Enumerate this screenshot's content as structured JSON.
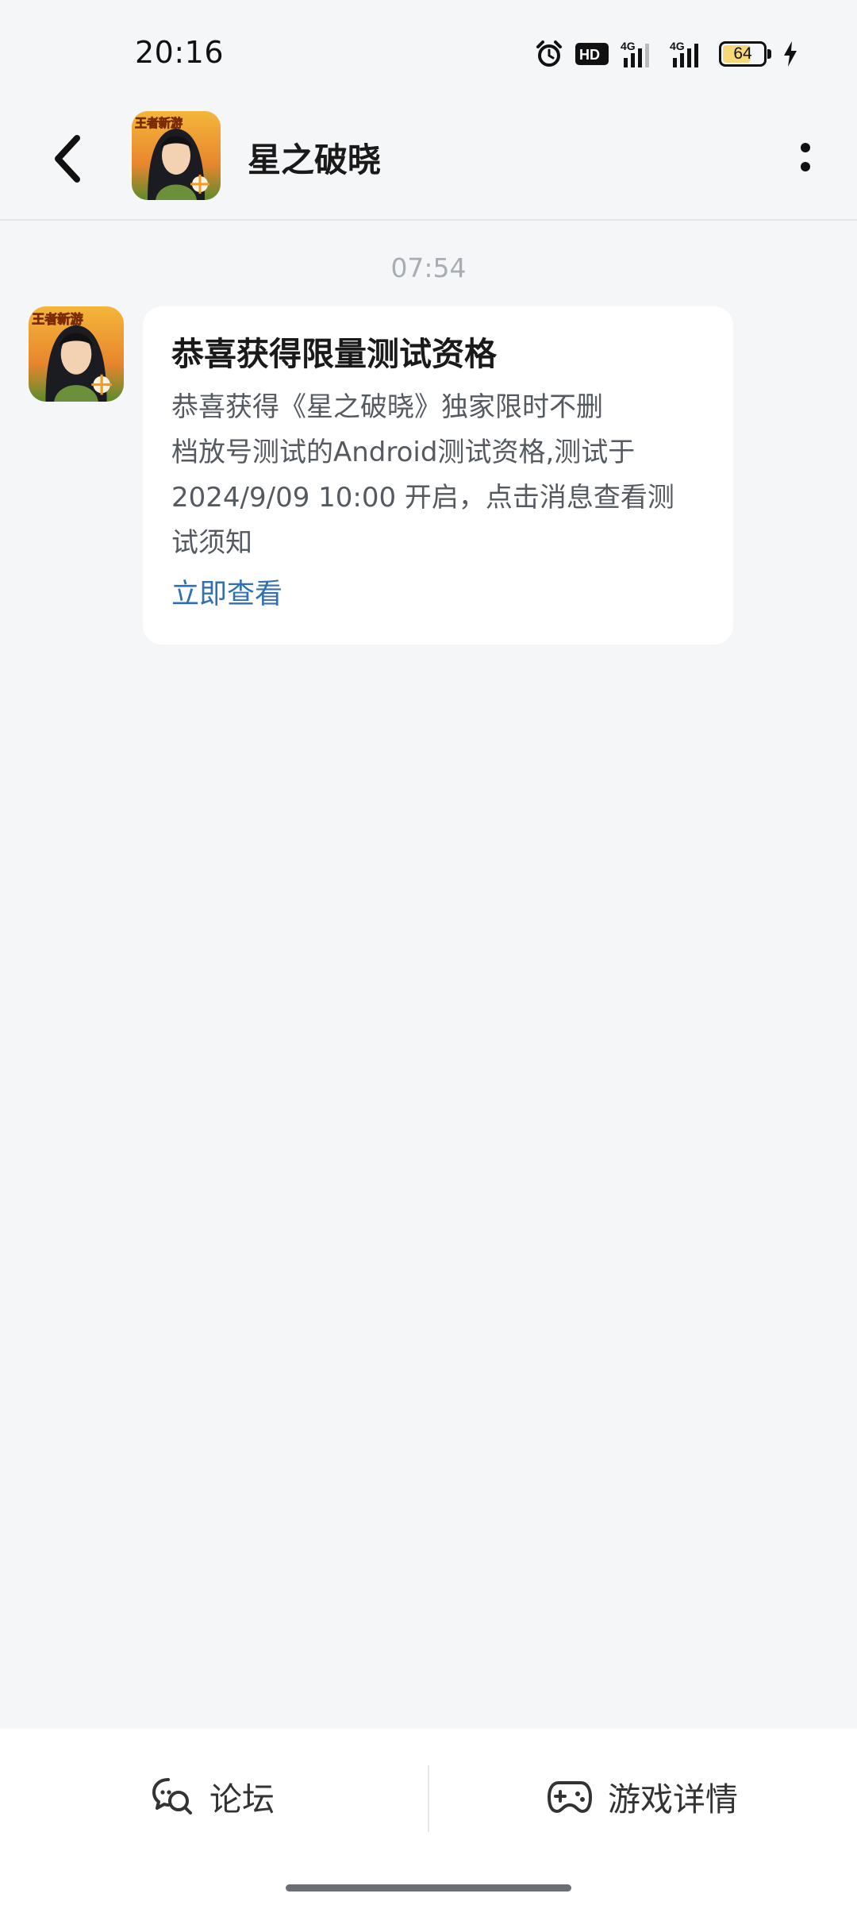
{
  "status_bar": {
    "time": "20:16",
    "hd_label": "HD",
    "network_1": "4G",
    "network_2": "4G",
    "battery_level": "64",
    "battery_fraction": 0.64,
    "icons": [
      "alarm-icon",
      "hd-icon",
      "signal-4g-icon",
      "signal-4g-icon",
      "battery-icon",
      "charging-icon"
    ]
  },
  "header": {
    "title": "星之破晓",
    "avatar_badge": "王者新游"
  },
  "chat": {
    "timestamp": "07:54",
    "message": {
      "title": "恭喜获得限量测试资格",
      "body_lines": [
        "恭喜获得《星之破晓》独家限时不删",
        "档放号测试的Android测试资格,测试于",
        "2024/9/09 10:00 开启，点击消息查看测",
        "试须知"
      ],
      "link": "立即查看"
    }
  },
  "bottom_bar": {
    "forum_label": "论坛",
    "details_label": "游戏详情"
  },
  "colors": {
    "background": "#f5f6f8",
    "card": "#ffffff",
    "link": "#2f6fb3",
    "timestamp": "#a8acb3",
    "battery_fill": "#f6d77a"
  }
}
